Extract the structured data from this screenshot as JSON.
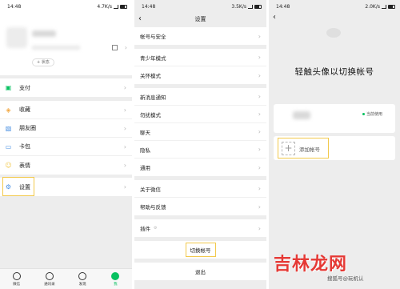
{
  "phone1": {
    "status": {
      "time": "14:48",
      "speed": "4.7K/s"
    },
    "profile": {
      "status_btn": "+ 状态"
    },
    "menu": [
      {
        "label": "支付",
        "icon": "payment-icon",
        "color": "#07c160"
      },
      {
        "label": "收藏",
        "icon": "favorites-icon",
        "color": "#f2a742"
      },
      {
        "label": "朋友圈",
        "icon": "moments-icon",
        "color": "#4a90e2"
      },
      {
        "label": "卡包",
        "icon": "card-wallet-icon",
        "color": "#4a90e2"
      },
      {
        "label": "表情",
        "icon": "sticker-icon",
        "color": "#f2c94c"
      },
      {
        "label": "设置",
        "icon": "gear-icon",
        "color": "#4a90e2"
      }
    ],
    "tabs": [
      {
        "label": "微信",
        "icon": "chat-icon"
      },
      {
        "label": "通讯录",
        "icon": "contacts-icon"
      },
      {
        "label": "发现",
        "icon": "discover-icon"
      },
      {
        "label": "我",
        "icon": "me-icon"
      }
    ]
  },
  "phone2": {
    "status": {
      "time": "14:48",
      "speed": "3.5K/s"
    },
    "title": "设置",
    "groups": [
      [
        "帐号与安全"
      ],
      [
        "青少年模式",
        "关怀模式"
      ],
      [
        "新消息通知",
        "勿扰模式",
        "聊天",
        "隐私",
        "通用"
      ],
      [
        "关于微信",
        "帮助与反馈"
      ],
      [
        "插件"
      ]
    ],
    "switch_account": "切换帐号",
    "logout": "退出"
  },
  "phone3": {
    "status": {
      "time": "14:48",
      "speed": "2.0K/s"
    },
    "title": "轻触头像以切换帐号",
    "current_label": "当前使用",
    "add_label": "添加帐号"
  },
  "watermark": {
    "brand": "吉林龙网",
    "credit": "搜狐号@玩机认"
  }
}
